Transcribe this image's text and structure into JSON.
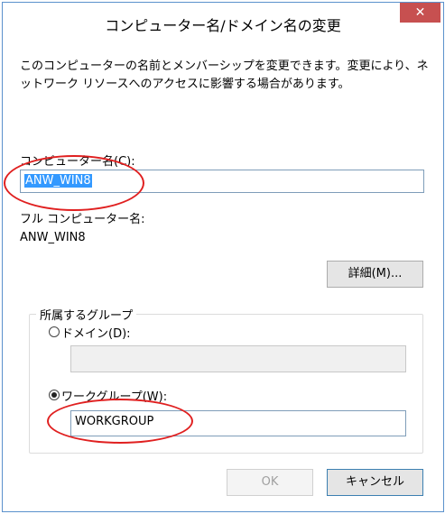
{
  "dialog": {
    "title": "コンピューター名/ドメイン名の変更",
    "close_glyph": "✕",
    "description": "このコンピューターの名前とメンバーシップを変更できます。変更により、ネットワーク リソースへのアクセスに影響する場合があります。",
    "computer_name_label": "コンピューター名(C):",
    "computer_name_value": "ANW_WIN8",
    "full_name_label": "フル コンピューター名:",
    "full_name_value": "ANW_WIN8",
    "details_button": "詳細(M)...",
    "group_title": "所属するグループ",
    "domain_label": "ドメイン(D):",
    "domain_value": "",
    "workgroup_label": "ワークグループ(W):",
    "workgroup_value": "WORKGROUP",
    "ok_button": "OK",
    "cancel_button": "キャンセル"
  },
  "colors": {
    "accent": "#3399ff",
    "close_button": "#c75050",
    "highlight_ellipse": "#e02020"
  },
  "state": {
    "selected_membership": "workgroup",
    "ok_enabled": false
  }
}
